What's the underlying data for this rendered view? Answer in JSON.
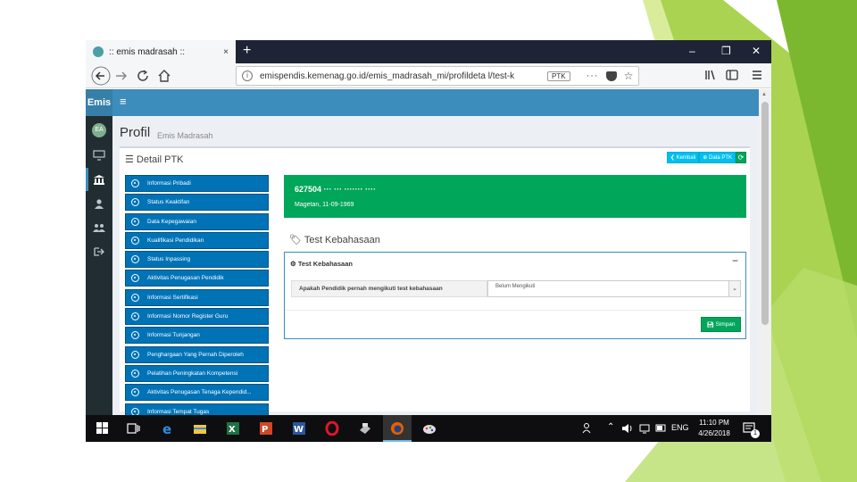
{
  "browser": {
    "tab_title": ":: emis madrasah ::",
    "tab_close": "×",
    "new_tab": "+",
    "window_controls": [
      "–",
      "❐",
      "✕"
    ],
    "url": "emispendis.kemenag.go.id/emis_madrasah_mi/profildeta l/test-k",
    "url_badge": "PTK",
    "url_more": "···",
    "icons": [
      "back-icon",
      "forward-icon",
      "reload-icon",
      "home-icon",
      "library-icon",
      "sidebar-icon",
      "hamburger-icon"
    ]
  },
  "app": {
    "brand": "Emis",
    "avatar_initials": "EA",
    "sidebar_icons": [
      "desktop-icon",
      "bank-icon",
      "user-icon",
      "users-icon",
      "signout-icon"
    ],
    "page_title": "Profil",
    "page_subtitle": "Emis Madrasah",
    "box_title": "Detail PTK",
    "buttons": {
      "back": "Kembali",
      "data": "Data PTK",
      "refresh": "⟳",
      "save": "Simpan"
    },
    "menu": [
      "Informasi Pribadi",
      "Status Keaktifan",
      "Data Kepegawaian",
      "Kualifikasi Pendidikan",
      "Status Inpassing",
      "Aktivitas Penugasan Pendidik",
      "Informasi Sertifikasi",
      "Informasi Nomor Register Guru",
      "Informasi Tunjangan",
      "Penghargaan Yang Pernah Diperoleh",
      "Pelatihan Peningkatan Kompetensi",
      "Aktivitas Penugasan Tenaga Kependid...",
      "Informasi Tempat Tugas"
    ],
    "id_card": {
      "name": "627504 ··· ··· ······· ····",
      "birth": "Magetan, 11-09-1969"
    },
    "section_title": "Test Kebahasaan",
    "panel": {
      "title": "Test Kebahasaan",
      "collapse": "−",
      "question": "Apakah Pendidik pernah mengikuti test kebahasaan",
      "answer": "Belum Mengikuti"
    }
  },
  "taskbar": {
    "apps": [
      "windows-start-icon",
      "task-view-icon",
      "edge-icon",
      "file-explorer-icon",
      "excel-icon",
      "powerpoint-icon",
      "word-icon",
      "opera-icon",
      "printer-icon",
      "firefox-icon",
      "paint-icon"
    ],
    "language": "ENG",
    "time": "11:10 PM",
    "date": "4/26/2018",
    "notification_count": "1"
  },
  "colors": {
    "header_blue": "#3c8dbc",
    "menu_blue": "#0073b7",
    "success_green": "#00a65a",
    "info_cyan": "#00c0ef",
    "sidebar_dark": "#222d32",
    "slide_accent_green": "#8dc63f"
  }
}
